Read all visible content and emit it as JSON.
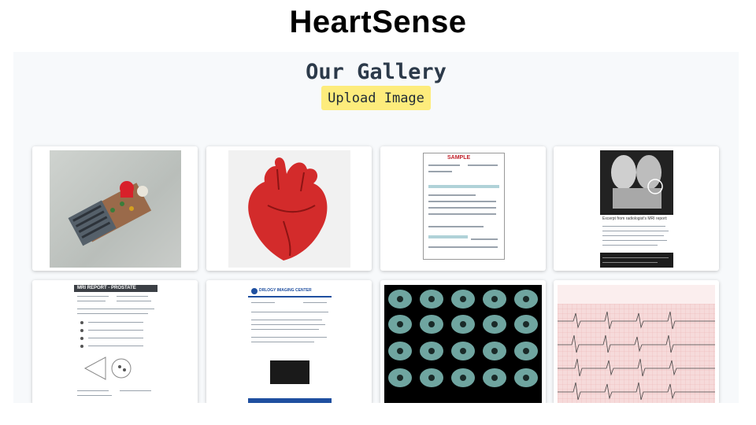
{
  "header": {
    "title": "HeartSense"
  },
  "gallery": {
    "title": "Our Gallery",
    "upload_label": "Upload Image",
    "items": [
      {
        "icon": "circuit-board-photo",
        "caption": ""
      },
      {
        "icon": "anatomical-heart-illustration",
        "caption": ""
      },
      {
        "icon": "medical-bill-document",
        "caption": "SAMPLE"
      },
      {
        "icon": "mri-knee-report",
        "caption": "Excerpt from radiologist's MRI report:"
      },
      {
        "icon": "mri-report-prostate",
        "caption": "MRI REPORT - PROSTATE"
      },
      {
        "icon": "imaging-center-report",
        "caption": "DRLOGY IMAGING CENTER"
      },
      {
        "icon": "ct-scan-grid",
        "caption": ""
      },
      {
        "icon": "ecg-strip",
        "caption": ""
      }
    ]
  },
  "colors": {
    "accent": "#fdec7c",
    "panel": "#f7f9fb",
    "title": "#2c3a4a"
  }
}
